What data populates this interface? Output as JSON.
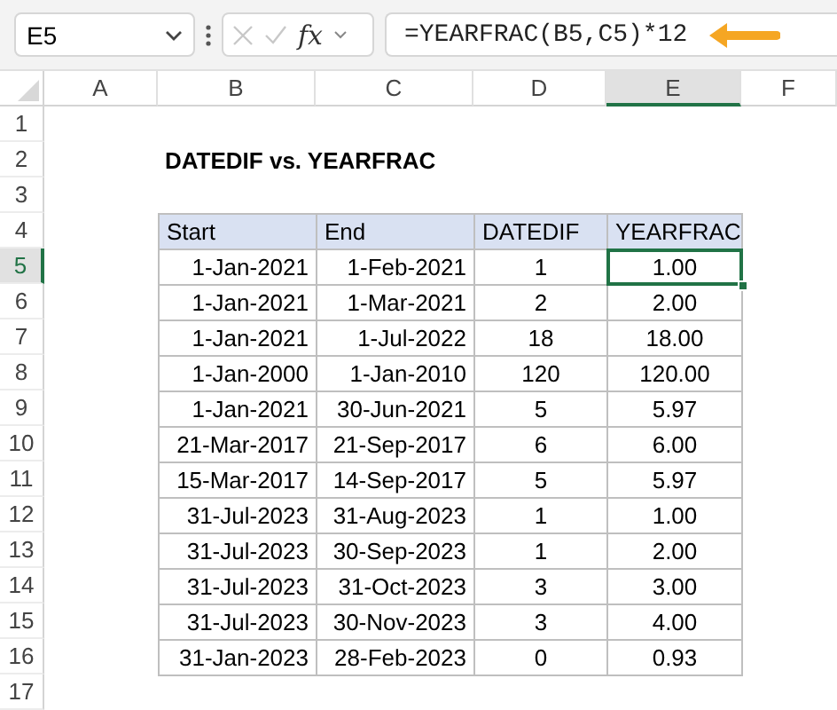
{
  "name_box": {
    "value": "E5"
  },
  "formula_bar": {
    "fx_label": "fx",
    "formula": "=YEARFRAC(B5,C5)*12"
  },
  "column_headers": [
    {
      "label": "A",
      "selected": false
    },
    {
      "label": "B",
      "selected": false
    },
    {
      "label": "C",
      "selected": false
    },
    {
      "label": "D",
      "selected": false
    },
    {
      "label": "E",
      "selected": true
    },
    {
      "label": "F",
      "selected": false
    }
  ],
  "row_headers": [
    {
      "label": "1",
      "selected": false
    },
    {
      "label": "2",
      "selected": false
    },
    {
      "label": "3",
      "selected": false
    },
    {
      "label": "4",
      "selected": false
    },
    {
      "label": "5",
      "selected": true
    },
    {
      "label": "6",
      "selected": false
    },
    {
      "label": "7",
      "selected": false
    },
    {
      "label": "8",
      "selected": false
    },
    {
      "label": "9",
      "selected": false
    },
    {
      "label": "10",
      "selected": false
    },
    {
      "label": "11",
      "selected": false
    },
    {
      "label": "12",
      "selected": false
    },
    {
      "label": "13",
      "selected": false
    },
    {
      "label": "14",
      "selected": false
    },
    {
      "label": "15",
      "selected": false
    },
    {
      "label": "16",
      "selected": false
    },
    {
      "label": "17",
      "selected": false
    }
  ],
  "title": "DATEDIF vs. YEARFRAC",
  "table": {
    "columns": [
      "Start",
      "End",
      "DATEDIF",
      "YEARFRAC"
    ],
    "rows": [
      {
        "start": "1-Jan-2021",
        "end": "1-Feb-2021",
        "datedif": "1",
        "yearfrac": "1.00",
        "selected": true
      },
      {
        "start": "1-Jan-2021",
        "end": "1-Mar-2021",
        "datedif": "2",
        "yearfrac": "2.00",
        "selected": false
      },
      {
        "start": "1-Jan-2021",
        "end": "1-Jul-2022",
        "datedif": "18",
        "yearfrac": "18.00",
        "selected": false
      },
      {
        "start": "1-Jan-2000",
        "end": "1-Jan-2010",
        "datedif": "120",
        "yearfrac": "120.00",
        "selected": false
      },
      {
        "start": "1-Jan-2021",
        "end": "30-Jun-2021",
        "datedif": "5",
        "yearfrac": "5.97",
        "selected": false
      },
      {
        "start": "21-Mar-2017",
        "end": "21-Sep-2017",
        "datedif": "6",
        "yearfrac": "6.00",
        "selected": false
      },
      {
        "start": "15-Mar-2017",
        "end": "14-Sep-2017",
        "datedif": "5",
        "yearfrac": "5.97",
        "selected": false
      },
      {
        "start": "31-Jul-2023",
        "end": "31-Aug-2023",
        "datedif": "1",
        "yearfrac": "1.00",
        "selected": false
      },
      {
        "start": "31-Jul-2023",
        "end": "30-Sep-2023",
        "datedif": "1",
        "yearfrac": "2.00",
        "selected": false
      },
      {
        "start": "31-Jul-2023",
        "end": "31-Oct-2023",
        "datedif": "3",
        "yearfrac": "3.00",
        "selected": false
      },
      {
        "start": "31-Jul-2023",
        "end": "30-Nov-2023",
        "datedif": "3",
        "yearfrac": "4.00",
        "selected": false
      },
      {
        "start": "31-Jan-2023",
        "end": "28-Feb-2023",
        "datedif": "0",
        "yearfrac": "0.93",
        "selected": false
      }
    ]
  }
}
